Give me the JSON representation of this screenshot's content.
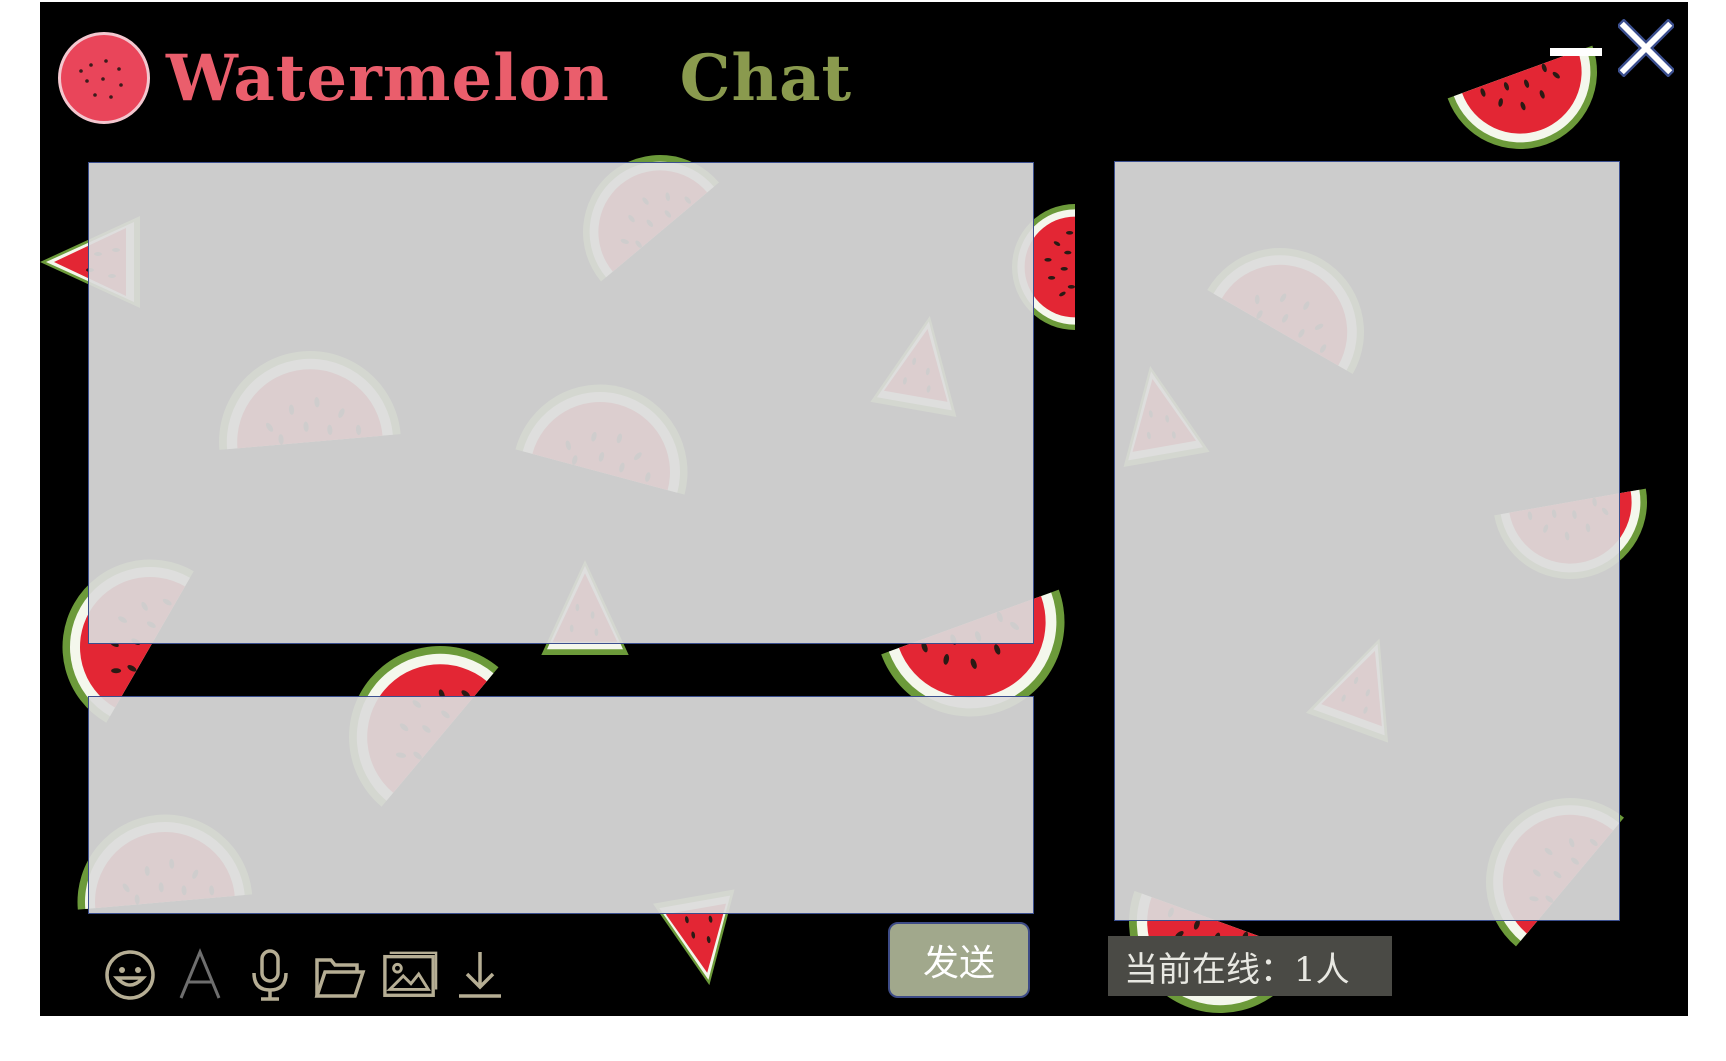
{
  "window": {
    "title_part1": "Watermelon",
    "title_part2": "Chat"
  },
  "titlebar": {
    "minimize_icon": "minus-icon",
    "close_icon": "close-icon"
  },
  "toolbar": {
    "icons": [
      "emoji-icon",
      "font-icon",
      "microphone-icon",
      "folder-icon",
      "image-icon",
      "download-icon"
    ]
  },
  "send_button": {
    "label": "发送"
  },
  "status": {
    "online_text": "当前在线：1人"
  },
  "colors": {
    "background": "#000000",
    "panel": "#dcdcdc",
    "panel_border": "#3b4f8f",
    "melon_red": "#e62a36",
    "send_button": "#a1a88c",
    "title_red": "#ea5e6c",
    "title_green": "#8a9a4e"
  }
}
